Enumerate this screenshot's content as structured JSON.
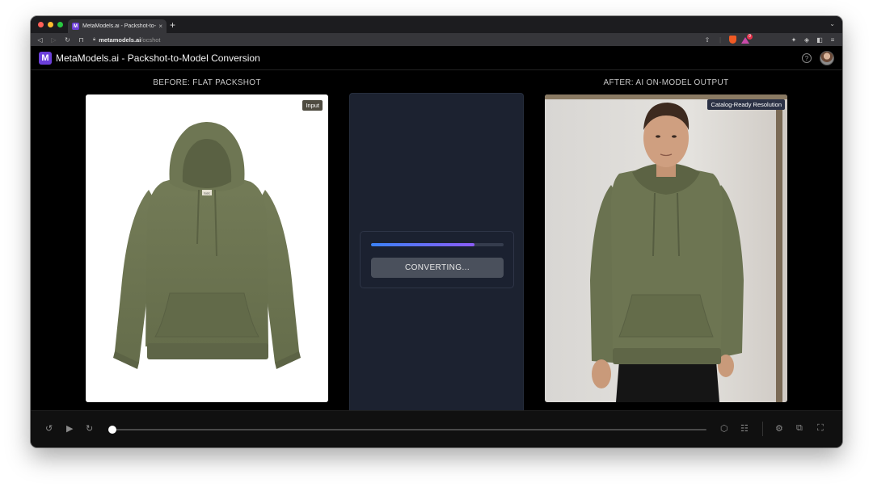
{
  "browser": {
    "tab_title": "MetaModels.ai - Packshot-to-",
    "tab_close": "×",
    "new_tab": "+",
    "url_host": "metamodels.ai",
    "url_path": "/ocshot",
    "rewards_count": "9"
  },
  "app": {
    "logo_letter": "M",
    "title": "MetaModels.ai - Packshot-to-Model Conversion",
    "help": "?"
  },
  "before": {
    "label": "BEFORE: FLAT PACKSHOT",
    "badge": "Input",
    "hoodie_tag": "basic"
  },
  "after": {
    "label": "AFTER: AI ON-MODEL OUTPUT",
    "badge": "Catalog-Ready Resolution"
  },
  "conversion": {
    "status_label": "CONVERTING...",
    "progress_percent": 78
  },
  "player": {
    "position_percent": 0
  },
  "colors": {
    "hoodie_olive": "#6b7350",
    "brand_purple": "#6b3fd9",
    "progress_start": "#3b82f6",
    "progress_end": "#8b5cf6"
  }
}
